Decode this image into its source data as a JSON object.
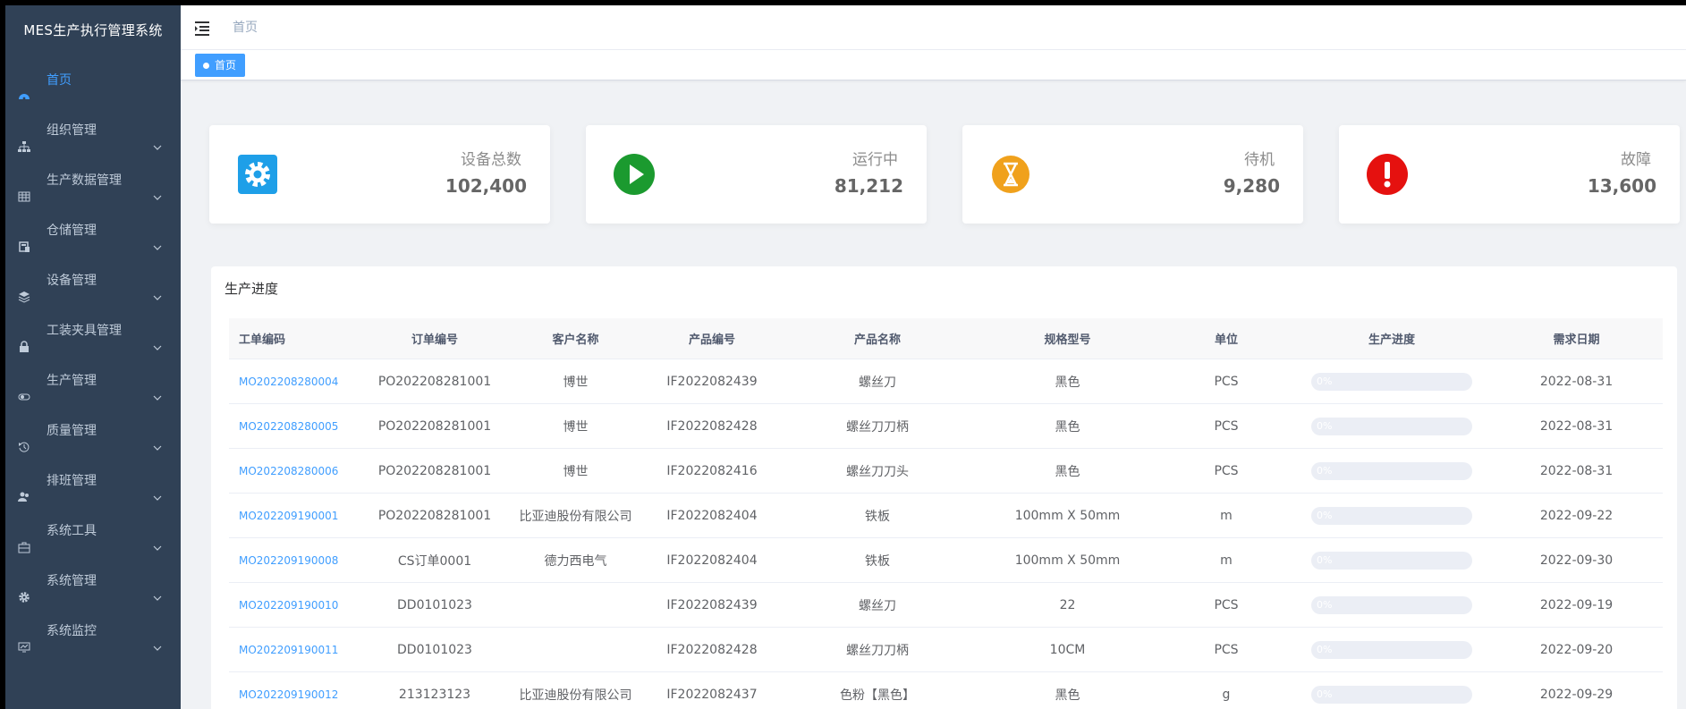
{
  "app": {
    "title": "MES生产执行管理系统"
  },
  "sidebar": {
    "items": [
      {
        "label": "首页",
        "icon": "dashboard-icon",
        "active": true
      },
      {
        "label": "组织管理",
        "icon": "org-tree-icon"
      },
      {
        "label": "生产数据管理",
        "icon": "table-icon"
      },
      {
        "label": "仓储管理",
        "icon": "warehouse-icon"
      },
      {
        "label": "设备管理",
        "icon": "layers-icon"
      },
      {
        "label": "工装夹具管理",
        "icon": "lock-icon"
      },
      {
        "label": "生产管理",
        "icon": "toggle-icon"
      },
      {
        "label": "质量管理",
        "icon": "history-icon"
      },
      {
        "label": "排班管理",
        "icon": "users-icon"
      },
      {
        "label": "系统工具",
        "icon": "toolbox-icon"
      },
      {
        "label": "系统管理",
        "icon": "gear-icon"
      },
      {
        "label": "系统监控",
        "icon": "monitor-icon"
      }
    ]
  },
  "navbar": {
    "breadcrumb": "首页"
  },
  "tags": {
    "active": "首页"
  },
  "stats": [
    {
      "label": "设备总数",
      "value": "102,400",
      "icon": "gear-icon",
      "color": "#1e9fe8"
    },
    {
      "label": "运行中",
      "value": "81,212",
      "icon": "play-icon",
      "color": "#1b9a2f"
    },
    {
      "label": "待机",
      "value": "9,280",
      "icon": "hourglass-icon",
      "color": "#f0a11c"
    },
    {
      "label": "故障",
      "value": "13,600",
      "icon": "alert-icon",
      "color": "#e5110f"
    }
  ],
  "progress_panel": {
    "title": "生产进度",
    "columns": [
      "工单编码",
      "订单编号",
      "客户名称",
      "产品编号",
      "产品名称",
      "规格型号",
      "单位",
      "生产进度",
      "需求日期"
    ],
    "rows": [
      {
        "work_order": "MO202208280004",
        "order_no": "PO202208281001",
        "customer": "博世",
        "product_no": "IF2022082439",
        "product_name": "螺丝刀",
        "spec": "黑色",
        "unit": "PCS",
        "progress": 0,
        "progress_label": "0%",
        "due": "2022-08-31"
      },
      {
        "work_order": "MO202208280005",
        "order_no": "PO202208281001",
        "customer": "博世",
        "product_no": "IF2022082428",
        "product_name": "螺丝刀刀柄",
        "spec": "黑色",
        "unit": "PCS",
        "progress": 0,
        "progress_label": "0%",
        "due": "2022-08-31"
      },
      {
        "work_order": "MO202208280006",
        "order_no": "PO202208281001",
        "customer": "博世",
        "product_no": "IF2022082416",
        "product_name": "螺丝刀刀头",
        "spec": "黑色",
        "unit": "PCS",
        "progress": 0,
        "progress_label": "0%",
        "due": "2022-08-31"
      },
      {
        "work_order": "MO202209190001",
        "order_no": "PO202208281001",
        "customer": "比亚迪股份有限公司",
        "product_no": "IF2022082404",
        "product_name": "铁板",
        "spec": "100mm X 50mm",
        "unit": "m",
        "progress": 0,
        "progress_label": "0%",
        "due": "2022-09-22"
      },
      {
        "work_order": "MO202209190008",
        "order_no": "CS订单0001",
        "customer": "德力西电气",
        "product_no": "IF2022082404",
        "product_name": "铁板",
        "spec": "100mm X 50mm",
        "unit": "m",
        "progress": 0,
        "progress_label": "0%",
        "due": "2022-09-30"
      },
      {
        "work_order": "MO202209190010",
        "order_no": "DD0101023",
        "customer": "",
        "product_no": "IF2022082439",
        "product_name": "螺丝刀",
        "spec": "22",
        "unit": "PCS",
        "progress": 0,
        "progress_label": "0%",
        "due": "2022-09-19"
      },
      {
        "work_order": "MO202209190011",
        "order_no": "DD0101023",
        "customer": "",
        "product_no": "IF2022082428",
        "product_name": "螺丝刀刀柄",
        "spec": "10CM",
        "unit": "PCS",
        "progress": 0,
        "progress_label": "0%",
        "due": "2022-09-20"
      },
      {
        "work_order": "MO202209190012",
        "order_no": "213123123",
        "customer": "比亚迪股份有限公司",
        "product_no": "IF2022082437",
        "product_name": "色粉【黑色】",
        "spec": "黑色",
        "unit": "g",
        "progress": 0,
        "progress_label": "0%",
        "due": "2022-09-29"
      }
    ]
  }
}
